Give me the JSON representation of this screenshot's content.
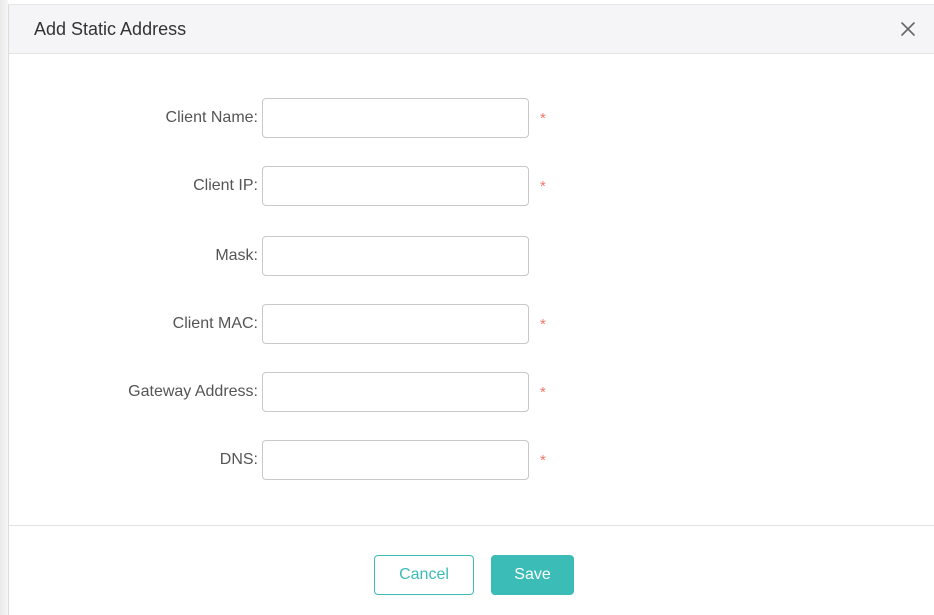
{
  "dialog": {
    "title": "Add Static Address",
    "close_icon": "close-icon"
  },
  "form": {
    "fields": [
      {
        "label": "Client Name:",
        "value": "",
        "placeholder": "",
        "required_mark": "*"
      },
      {
        "label": "Client IP:",
        "value": "",
        "placeholder": "",
        "required_mark": "*"
      },
      {
        "label": "Mask:",
        "value": "",
        "placeholder": "",
        "required_mark": ""
      },
      {
        "label": "Client MAC:",
        "value": "",
        "placeholder": "",
        "required_mark": "*"
      },
      {
        "label": "Gateway Address:",
        "value": "",
        "placeholder": "",
        "required_mark": "*"
      },
      {
        "label": "DNS:",
        "value": "",
        "placeholder": "",
        "required_mark": "*"
      }
    ]
  },
  "footer": {
    "cancel_label": "Cancel",
    "save_label": "Save"
  },
  "colors": {
    "accent": "#3cbcb6",
    "required": "#f0786c",
    "header_bg": "#f5f5f7"
  }
}
